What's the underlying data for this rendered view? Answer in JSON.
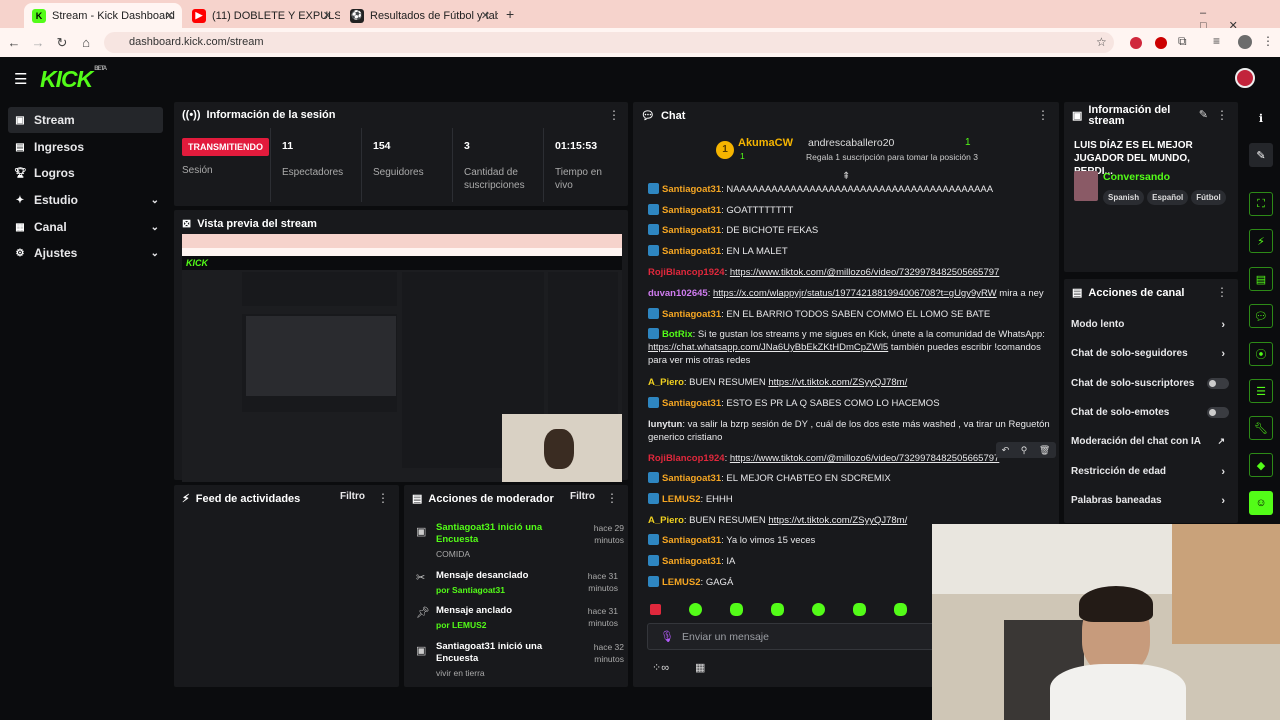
{
  "browser": {
    "tabs": [
      {
        "title": "Stream - Kick Dashboard",
        "favicon": "kick-icon"
      },
      {
        "title": "(11) DOBLETE Y EXPULSIÓN DE",
        "favicon": "youtube-icon"
      },
      {
        "title": "Resultados de Fútbol y tabla de",
        "favicon": "soccer-icon"
      }
    ],
    "url": "dashboard.kick.com/stream"
  },
  "brand": {
    "logo": "KICK",
    "sup": "BETA",
    "accent": "#53fc18"
  },
  "sidebar": {
    "items": [
      {
        "label": "Stream",
        "icon": "stream-icon",
        "selected": true
      },
      {
        "label": "Ingresos",
        "icon": "money-icon"
      },
      {
        "label": "Logros",
        "icon": "trophy-icon"
      },
      {
        "label": "Estudio",
        "icon": "studio-icon"
      },
      {
        "label": "Canal",
        "icon": "channel-icon"
      },
      {
        "label": "Ajustes",
        "icon": "gear-icon"
      }
    ]
  },
  "session": {
    "title": "Información de la sesión",
    "status": "TRANSMITIENDO",
    "status_label": "Sesión",
    "stats": [
      {
        "value": "11",
        "label": "Espectadores"
      },
      {
        "value": "154",
        "label": "Seguidores"
      },
      {
        "value": "3",
        "label": "Cantidad de suscripciones"
      },
      {
        "value": "01:15:53",
        "label": "Tiempo en vivo"
      }
    ]
  },
  "preview": {
    "title": "Vista previa del stream"
  },
  "activity": {
    "title": "Feed de actividades",
    "filter": "Filtro"
  },
  "modactions": {
    "title": "Acciones de moderador",
    "filter": "Filtro",
    "items": [
      {
        "title": "Santiagoat31 inició una Encuesta",
        "sub": "COMIDA",
        "time": "hace 29 minutos",
        "icon": "poll-icon"
      },
      {
        "title": "Mensaje desanclado",
        "sub": "por Santiagoat31",
        "time": "hace 31 minutos",
        "icon": "unpin-icon"
      },
      {
        "title": "Mensaje anclado",
        "sub": "por LEMUS2",
        "time": "hace 31 minutos",
        "icon": "pin-icon"
      },
      {
        "title": "Santiagoat31 inició una Encuesta",
        "sub": "vivir en tierra",
        "time": "hace 32 minutos",
        "icon": "poll-icon"
      }
    ]
  },
  "chat": {
    "title": "Chat",
    "leaderboard": {
      "first": "AkumaCW",
      "first_rank": "1",
      "second": "andrescaballero20",
      "second_rank": "1",
      "gift_note": "Regala 1 suscripción para tomar la posición 3"
    },
    "messages": [
      {
        "user": "Santiagoat31",
        "color": "#f5a623",
        "mod": true,
        "text": ": NAAAAAAAAAAAAAAAAAAAAAAAAAAAAAAAAAAAAAAAAA",
        "link": ""
      },
      {
        "user": "Santiagoat31",
        "color": "#f5a623",
        "mod": true,
        "text": ": GOATTTTTTTT",
        "link": ""
      },
      {
        "user": "Santiagoat31",
        "color": "#f5a623",
        "mod": true,
        "text": ": DE BICHOTE FEKAS",
        "link": ""
      },
      {
        "user": "Santiagoat31",
        "color": "#f5a623",
        "mod": true,
        "text": ": EN LA MALET",
        "link": ""
      },
      {
        "user": "RojiBlancop1924",
        "color": "#e0283c",
        "mod": false,
        "text": ": ",
        "link": "https://www.tiktok.com/@millozo6/video/7329978482505665797"
      },
      {
        "user": "duvan102645",
        "color": "#d07cf0",
        "mod": false,
        "text": ": ",
        "link": "https://x.com/wlappyjr/status/1977421881994006708?t=gUgy9yRW",
        "after": " mira a ney"
      },
      {
        "user": "Santiagoat31",
        "color": "#f5a623",
        "mod": true,
        "text": ": EN EL BARRIO TODOS SABEN COMMO EL LOMO SE BATE",
        "link": ""
      },
      {
        "user": "BotRix",
        "color": "#53fc18",
        "mod": true,
        "text": ": Si te gustan los streams y me sigues en Kick, únete a la comunidad de WhatsApp: ",
        "link": "https://chat.whatsapp.com/JNa6UyBbEkZKtHDmCpZWl5",
        "after": " también puedes escribir !comandos para ver mis otras redes"
      },
      {
        "user": "A_Piero",
        "color": "#f0d020",
        "mod": false,
        "text": ": BUEN RESUMEN ",
        "link": "https://vt.tiktok.com/ZSyyQJ78m/"
      },
      {
        "user": "Santiagoat31",
        "color": "#f5a623",
        "mod": true,
        "text": ": ESTO ES PR LA Q SABES COMO LO HACEMOS",
        "link": ""
      },
      {
        "user": "lunytun",
        "color": "#e8e8ea",
        "mod": false,
        "text": ": va salir la bzrp sesión de DY , cuál de los dos este más washed , va tirar un Reguetón generico cristiano",
        "link": ""
      },
      {
        "user": "RojiBlancop1924",
        "color": "#e0283c",
        "mod": false,
        "text": ": ",
        "link": "https://www.tiktok.com/@millozo6/video/7329978482505665797"
      },
      {
        "user": "Santiagoat31",
        "color": "#f5a623",
        "mod": true,
        "text": ": EL MEJOR CHABTEO EN SDCREMIX",
        "link": ""
      },
      {
        "user": "LEMUS2",
        "color": "#f5a623",
        "mod": true,
        "text": ": EHHH",
        "link": ""
      },
      {
        "user": "A_Piero",
        "color": "#f0d020",
        "mod": false,
        "text": ": BUEN RESUMEN ",
        "link": "https://vt.tiktok.com/ZSyyQJ78m/"
      },
      {
        "user": "Santiagoat31",
        "color": "#f5a623",
        "mod": true,
        "text": ": Ya lo vimos 15 veces",
        "link": ""
      },
      {
        "user": "Santiagoat31",
        "color": "#f5a623",
        "mod": true,
        "text": ": IA",
        "link": ""
      },
      {
        "user": "LEMUS2",
        "color": "#f5a623",
        "mod": true,
        "text": ": GAGÁ",
        "link": ""
      }
    ],
    "input_placeholder": "Enviar un mensaje"
  },
  "streaminfo": {
    "title": "Información del stream",
    "stream_title": "LUIS DÍAZ ES EL MEJOR JUGADOR DEL MUNDO, PERDI...",
    "category": "Conversando",
    "tags": [
      "Spanish",
      "Español",
      "Fútbol"
    ]
  },
  "channel_actions": {
    "title": "Acciones de canal",
    "items": [
      {
        "label": "Modo lento",
        "type": "chevron"
      },
      {
        "label": "Chat de solo-seguidores",
        "type": "chevron"
      },
      {
        "label": "Chat de solo-suscriptores",
        "type": "toggle"
      },
      {
        "label": "Chat de solo-emotes",
        "type": "toggle"
      },
      {
        "label": "Moderación del chat con IA",
        "type": "external"
      },
      {
        "label": "Restricción de edad",
        "type": "chevron"
      },
      {
        "label": "Palabras baneadas",
        "type": "chevron"
      }
    ]
  }
}
